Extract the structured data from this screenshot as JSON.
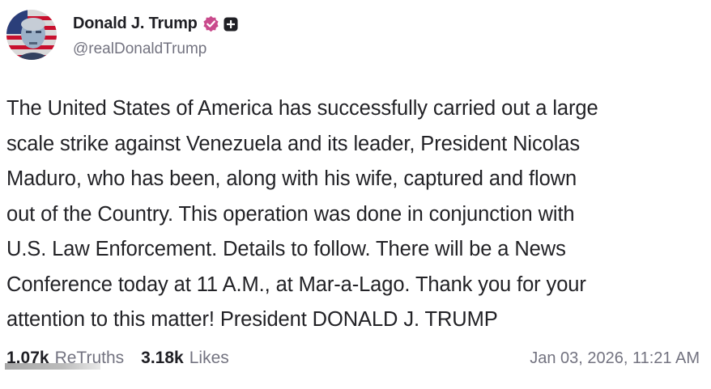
{
  "author": {
    "display_name": "Donald J. Trump",
    "handle": "@realDonaldTrump",
    "avatar_icon": "avatar-portrait-flag",
    "badge_icons": [
      "verified-icon",
      "plus-icon"
    ],
    "badge_color": "#c94a8c"
  },
  "post": {
    "text": "The United States of America has successfully carried out a large\nscale strike against Venezuela and its leader, President Nicolas\nMaduro, who has been, along with his wife, captured and flown\nout of the Country. This operation was done in conjunction with\nU.S. Law Enforcement. Details to follow. There will be a News\nConference today at 11 A.M., at Mar-a-Lago. Thank you for your\nattention to this matter! President DONALD J. TRUMP"
  },
  "stats": {
    "retruths_count": "1.07k",
    "retruths_label": "ReTruths",
    "likes_count": "3.18k",
    "likes_label": "Likes",
    "timestamp": "Jan 03, 2026, 11:21 AM"
  }
}
